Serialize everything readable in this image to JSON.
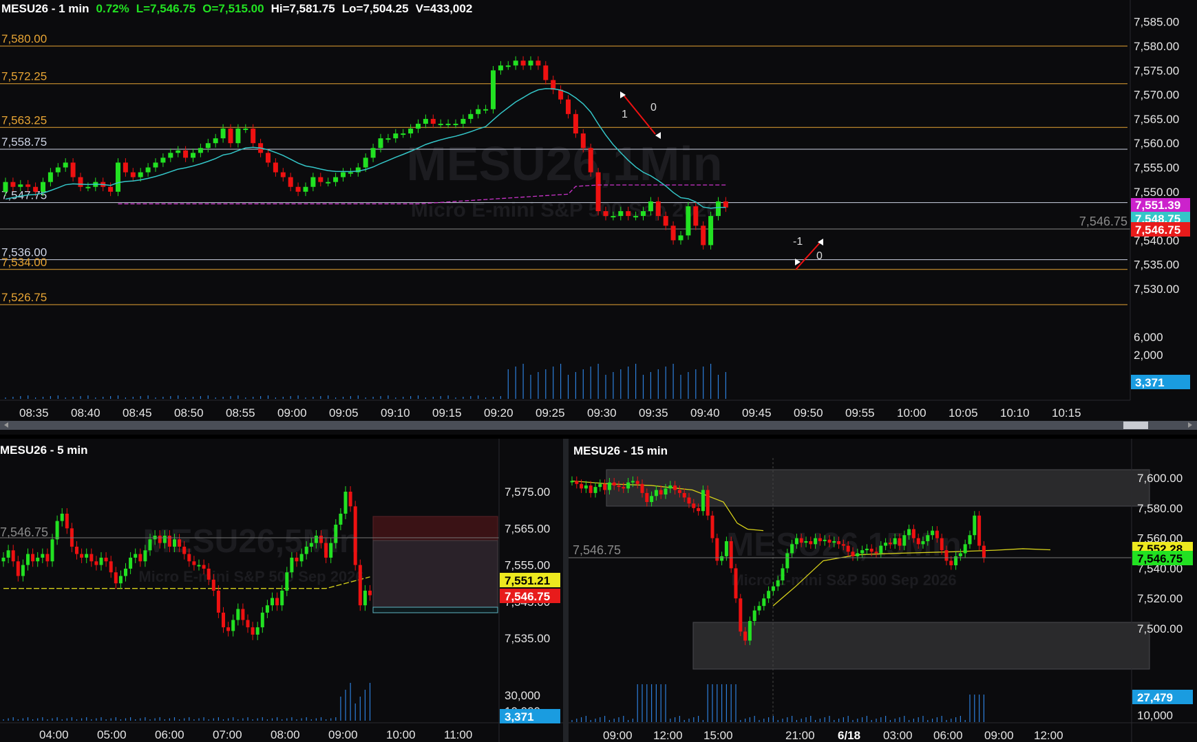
{
  "colors": {
    "up": "#22e122",
    "down": "#ee1111",
    "ema": "#34c6c8",
    "vwap": "#cc33cc",
    "yellow": "#d8d21a",
    "orange": "#e8a534",
    "white": "#cfd5e6",
    "price_tag": "#e81b1b",
    "vol": "#2d7fdc"
  },
  "top": {
    "header": {
      "symbol": "MESU26 - 1 min",
      "change": "0.72%",
      "last": "L=7,546.75",
      "open": "O=7,515.00",
      "high": "Hi=7,581.75",
      "low": "Lo=7,504.25",
      "volume": "V=433,002"
    },
    "watermark": {
      "title": "MESU26,1Min",
      "subtitle": "Micro E-mini S&P 500 Sep 2026"
    },
    "price_labels": [
      "7,585.00",
      "7,580.00",
      "7,575.00",
      "7,570.00",
      "7,565.00",
      "7,560.00",
      "7,555.00",
      "7,550.00",
      "7,545.00",
      "7,540.00",
      "7,535.00",
      "7,530.00"
    ],
    "volume_labels": [
      "6,000",
      "2,000"
    ],
    "level_labels": [
      "7,580.00",
      "7,572.25",
      "7,563.25",
      "7,558.75",
      "7,547.75",
      "7,536.00",
      "7,534.00",
      "7,526.75"
    ],
    "tags": {
      "vwap": "7,551.39",
      "ema": "7,548.75",
      "last": "7,546.75",
      "volume": "3,371"
    },
    "last_line_label": "7,546.75",
    "annotations": [
      "1",
      "0",
      "-1",
      "0"
    ],
    "time_labels": [
      "08:35",
      "08:40",
      "08:45",
      "08:50",
      "08:55",
      "09:00",
      "09:05",
      "09:10",
      "09:15",
      "09:20",
      "09:25",
      "09:30",
      "09:35",
      "09:40",
      "09:45",
      "09:50",
      "09:55",
      "10:00",
      "10:05",
      "10:10",
      "10:15"
    ]
  },
  "bottom_left": {
    "header": {
      "symbol": "MESU26 - 5 min"
    },
    "watermark": {
      "title": "MESU26,5Min",
      "subtitle": "Micro E-mini S&P 500 Sep 2026"
    },
    "price_labels": [
      "7,575.00",
      "7,565.00",
      "7,555.00",
      "7,545.00",
      "7,535.00"
    ],
    "volume_labels": [
      "30,000",
      "10,000"
    ],
    "tags": {
      "yellow": "7,551.21",
      "last": "7,546.75",
      "volume": "3,371"
    },
    "last_line_label": "7,546.75",
    "time_labels": [
      "04:00",
      "05:00",
      "06:00",
      "07:00",
      "08:00",
      "09:00",
      "10:00",
      "11:00"
    ]
  },
  "bottom_right": {
    "header": {
      "symbol": "MESU26 - 15 min"
    },
    "watermark": {
      "title": "MESU26,15Min",
      "subtitle": "Micro E-mini S&P 500 Sep 2026"
    },
    "price_labels": [
      "7,600.00",
      "7,580.00",
      "7,560.00",
      "7,540.00",
      "7,520.00",
      "7,500.00"
    ],
    "volume_labels": [
      "10,000"
    ],
    "tags": {
      "yellow": "7,552.28",
      "last": "7,546.75",
      "volume": "27,479"
    },
    "last_line_label": "7,546.75",
    "time_labels": [
      "09:00",
      "12:00",
      "15:00",
      "21:00",
      "6/18",
      "03:00",
      "06:00",
      "09:00",
      "12:00"
    ]
  }
}
